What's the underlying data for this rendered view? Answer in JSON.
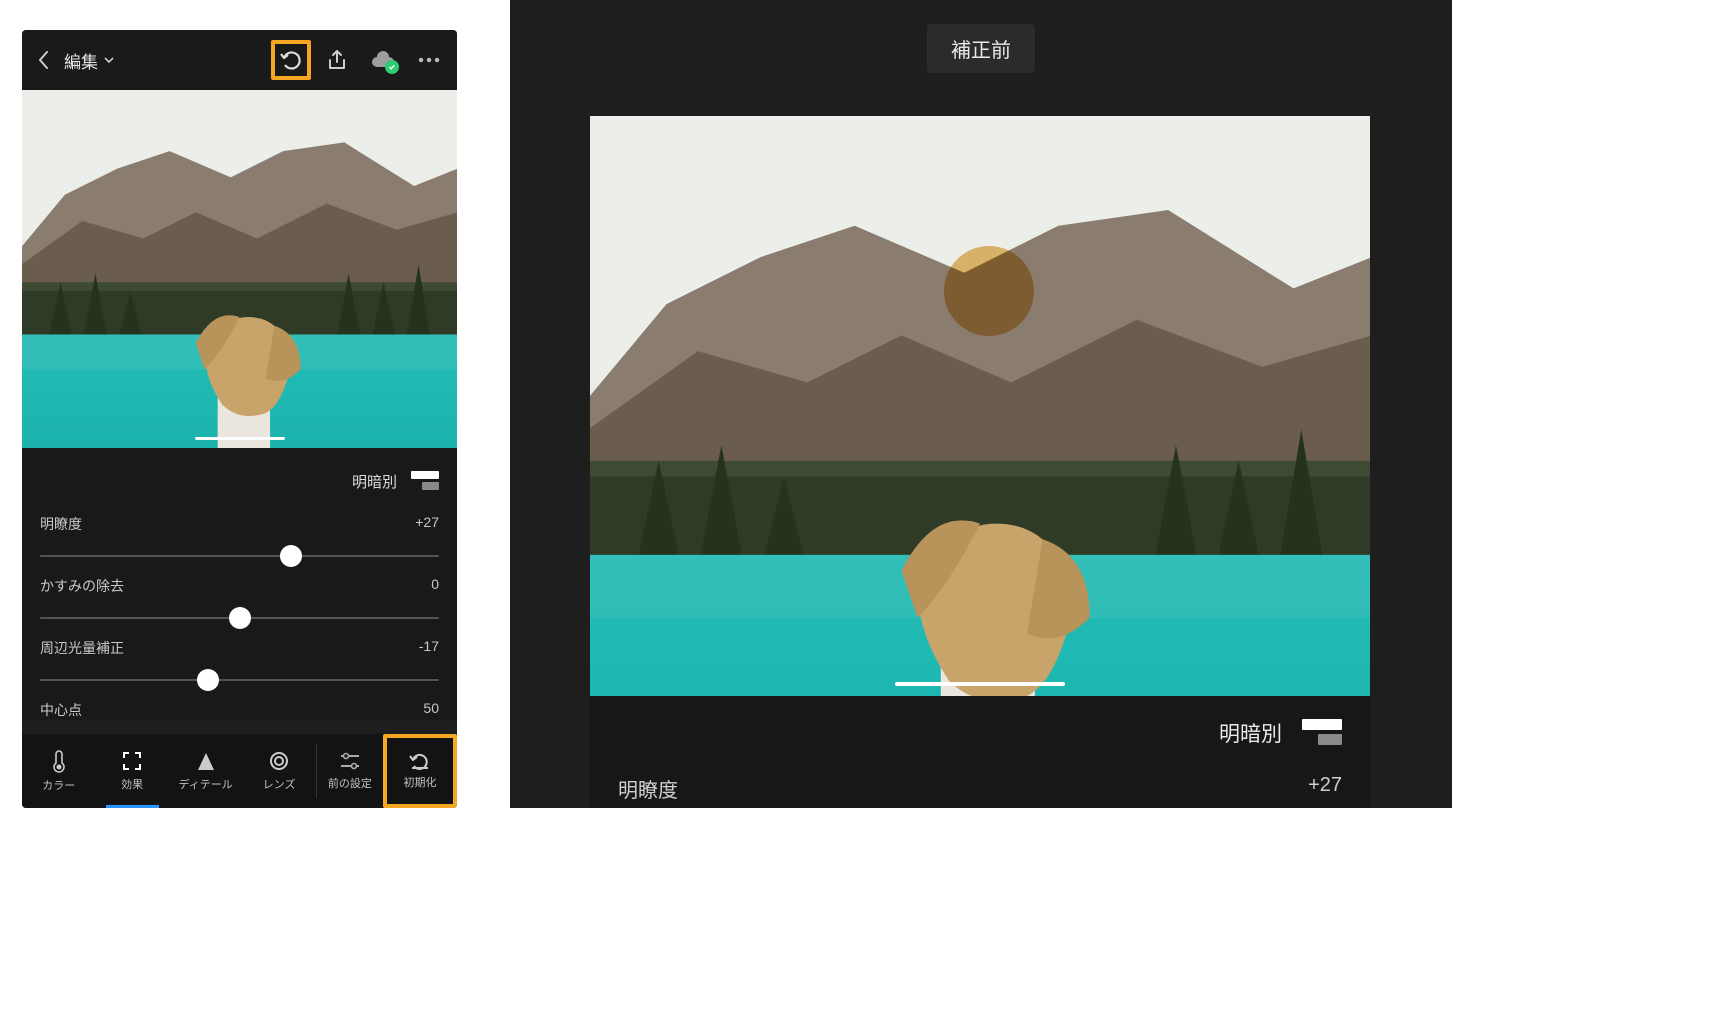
{
  "left": {
    "title": "編集",
    "toggleLabel": "明暗別",
    "sliders": [
      {
        "label": "明瞭度",
        "value": "+27",
        "pos": 63
      },
      {
        "label": "かすみの除去",
        "value": "0",
        "pos": 50
      },
      {
        "label": "周辺光量補正",
        "value": "-17",
        "pos": 42
      },
      {
        "label": "中心点",
        "value": "50",
        "pos": 50
      }
    ],
    "tabs": {
      "color": "カラー",
      "effect": "効果",
      "detail": "ディテール",
      "lens": "レンズ",
      "previous": "前の設定",
      "reset": "初期化"
    }
  },
  "right": {
    "beforeLabel": "補正前",
    "toggleLabel": "明暗別",
    "sliderLabel": "明瞭度",
    "sliderValue": "+27"
  }
}
